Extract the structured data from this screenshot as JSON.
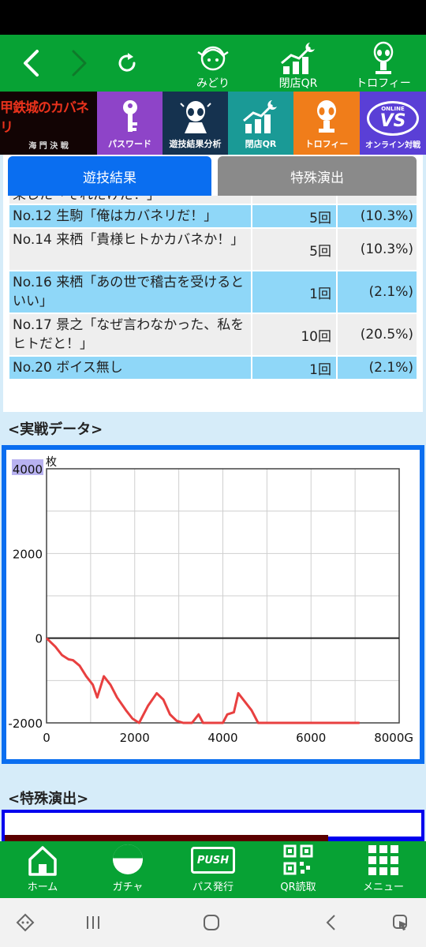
{
  "top_nav": {
    "back_icon": "chevron-left-icon",
    "forward_icon": "chevron-right-icon",
    "reload_icon": "reload-icon",
    "midori_label": "みどり",
    "closing_qr_label": "閉店QR",
    "trophy_label": "トロフィー"
  },
  "menu_strip": {
    "game_logo_text": "甲鉄城のカバネリ",
    "game_logo_sub": "海 門 決 戦",
    "tiles": [
      {
        "label": "パスワード",
        "color": "#8e44c8"
      },
      {
        "label": "遊技結果分析",
        "color": "#15324f"
      },
      {
        "label": "閉店QR",
        "color": "#1a9a96"
      },
      {
        "label": "トロフィー",
        "color": "#f07d1a"
      },
      {
        "label": "オンライン対戦",
        "color": "#5a3fd6"
      }
    ],
    "vs_badge": "VS",
    "online_badge": "ONLINE"
  },
  "tabs": {
    "results": "遊技結果",
    "special": "特殊演出"
  },
  "voice_table": {
    "partial_row": {
      "name": "果した「それだけだ！」",
      "count": "",
      "pct": ""
    },
    "rows": [
      {
        "name": "No.12 生駒「俺はカバネリだ！」",
        "count": "5回",
        "pct": "(10.3%)",
        "style": "blue",
        "h": 28
      },
      {
        "name": "No.14 来栖「貴様ヒトかカバネか！」",
        "count": "5回",
        "pct": "(10.3%)",
        "style": "gray",
        "h": 52
      },
      {
        "name": "No.16 来栖「あの世で稽古を受けるといい」",
        "count": "1回",
        "pct": "(2.1%)",
        "style": "blue",
        "h": 52
      },
      {
        "name": "No.17 景之「なぜ言わなかった、私をヒトだと！」",
        "count": "10回",
        "pct": "(20.5%)",
        "style": "gray",
        "h": 52
      },
      {
        "name": "No.20 ボイス無し",
        "count": "1回",
        "pct": "(2.1%)",
        "style": "blue",
        "h": 28
      }
    ]
  },
  "section_titles": {
    "actual_data": "<実戦データ>",
    "special_effects": "<特殊演出>"
  },
  "chart_data": {
    "type": "line",
    "title": "",
    "ylabel": "枚",
    "xlabel": "",
    "x_unit": "G",
    "xlim": [
      0,
      8000
    ],
    "ylim": [
      -2000,
      4000
    ],
    "x_ticks": [
      "0",
      "2000",
      "4000",
      "6000",
      "8000G"
    ],
    "y_ticks": [
      "4000",
      "2000",
      "0",
      "-2000"
    ],
    "grid": true,
    "series": [
      {
        "color": "#e84040",
        "x": [
          0,
          200,
          350,
          500,
          600,
          750,
          900,
          1050,
          1150,
          1300,
          1450,
          1600,
          1800,
          1950,
          2100,
          2300,
          2500,
          2650,
          2800,
          2950,
          3100,
          3300,
          3450,
          3550,
          3700,
          3850,
          4000,
          4100,
          4250,
          4350,
          4500,
          4650,
          4800,
          5000,
          5500,
          6000,
          6500,
          7000,
          7100
        ],
        "y": [
          0,
          -200,
          -400,
          -500,
          -520,
          -650,
          -900,
          -1100,
          -1400,
          -900,
          -1100,
          -1400,
          -1700,
          -1900,
          -2000,
          -1600,
          -1300,
          -1450,
          -1800,
          -1950,
          -2000,
          -2000,
          -1800,
          -2000,
          -2000,
          -2000,
          -2000,
          -1800,
          -1750,
          -1300,
          -1500,
          -1700,
          -2000,
          -2000,
          -2000,
          -2000,
          -2000,
          -2000,
          -2000
        ]
      }
    ]
  },
  "bottom_nav": {
    "items": [
      {
        "label": "ホーム",
        "icon": "home-icon"
      },
      {
        "label": "ガチャ",
        "icon": "gacha-icon"
      },
      {
        "label": "パス発行",
        "icon": "push-icon"
      },
      {
        "label": "QR読取",
        "icon": "qr-icon"
      },
      {
        "label": "メニュー",
        "icon": "menu-grid-icon"
      }
    ],
    "push_badge": "PUSH"
  },
  "system_bar": {
    "game_icon": "game-launcher-icon",
    "recents_icon": "recents-icon",
    "home_icon": "system-home-icon",
    "back_icon": "system-back-icon",
    "assist_icon": "assist-icon"
  }
}
